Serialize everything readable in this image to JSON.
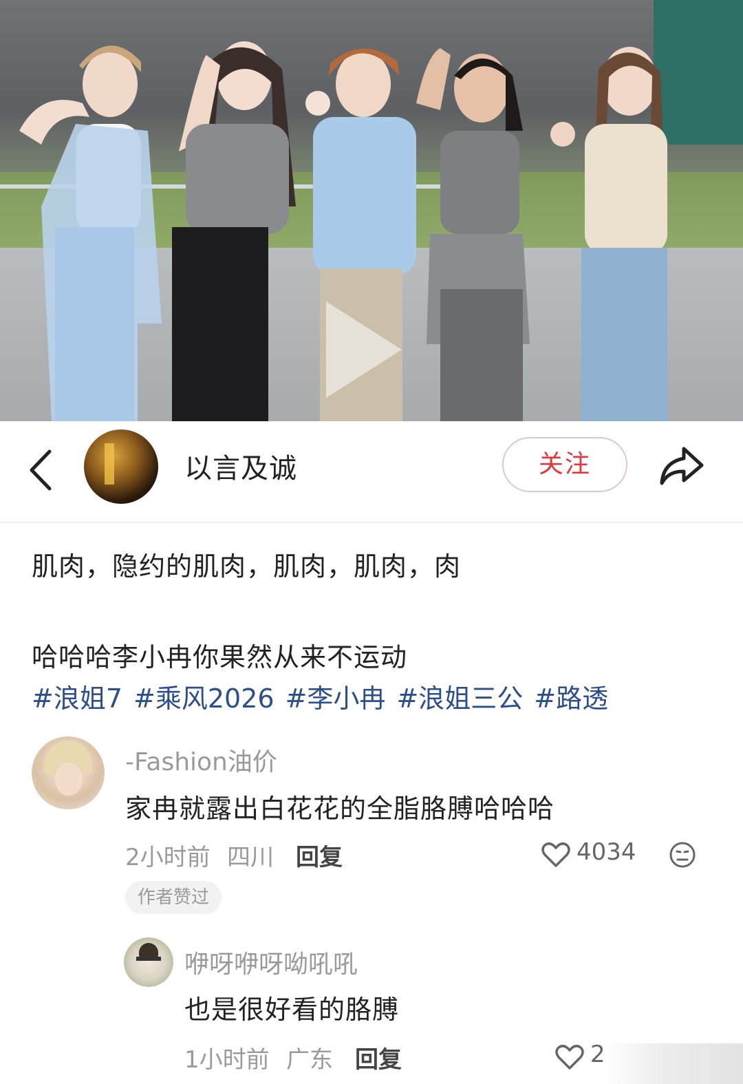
{
  "video": {
    "play_icon": "play-icon"
  },
  "author": {
    "back_icon": "chevron-left-icon",
    "name": "以言及诚",
    "follow_label": "关注",
    "share_icon": "share-icon"
  },
  "post": {
    "line1": "肌肉，隐约的肌肉，肌肉，肌肉，肉",
    "line2": "哈哈哈李小冉你果然从来不运动",
    "tags": [
      "#浪姐7",
      "#乘风2026",
      "#李小冉",
      "#浪姐三公",
      "#路透"
    ]
  },
  "comments": [
    {
      "username": "-Fashion油价",
      "text": "家冉就露出白花花的全脂胳膊哈哈哈",
      "time": "2小时前",
      "location": "四川",
      "reply_label": "回复",
      "likes": "4034",
      "badge": "作者赞过",
      "emoji_icon": "neutral-face-icon"
    },
    {
      "username": "咿呀咿呀呦吼吼",
      "text": "也是很好看的胳膊",
      "time": "1小时前",
      "location": "广东",
      "reply_label": "回复",
      "likes": "2"
    }
  ],
  "colors": {
    "follow_red": "#e0383e",
    "tag_blue": "#2c4f8c",
    "meta_gray": "#9a9a9a"
  }
}
